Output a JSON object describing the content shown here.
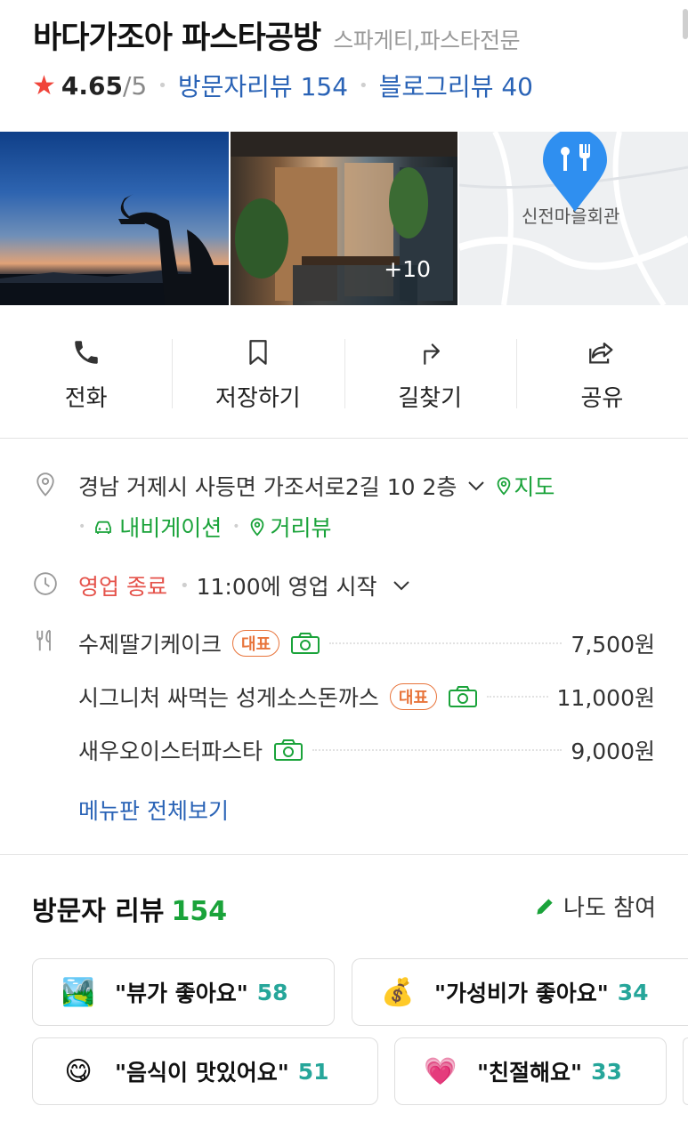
{
  "place": {
    "name": "바다가조아 파스타공방",
    "category": "스파게티,파스타전문",
    "rating": "4.65",
    "rating_max": "/5",
    "visitor_reviews_label": "방문자리뷰 154",
    "blog_reviews_label": "블로그리뷰 40"
  },
  "photos": {
    "more_count": "+10",
    "map_pin_label": "신전마을회관"
  },
  "actions": [
    {
      "label": "전화",
      "icon": "phone-icon"
    },
    {
      "label": "저장하기",
      "icon": "bookmark-icon"
    },
    {
      "label": "길찾기",
      "icon": "directions-icon"
    },
    {
      "label": "공유",
      "icon": "share-icon"
    }
  ],
  "address": {
    "text": "경남 거제시 사등면 가조서로2길 10 2층",
    "map_link": "지도",
    "navigation_link": "내비게이션",
    "streetview_link": "거리뷰"
  },
  "hours": {
    "status": "영업 종료",
    "next": "11:00에 영업 시작"
  },
  "menu": {
    "items": [
      {
        "name": "수제딸기케이크",
        "badge": "대표",
        "price": "7,500원"
      },
      {
        "name": "시그니처 싸먹는 성게소스돈까스",
        "badge": "대표",
        "price": "11,000원"
      },
      {
        "name": "새우오이스터파스타",
        "badge": "",
        "price": "9,000원"
      }
    ],
    "view_all": "메뉴판 전체보기"
  },
  "reviews": {
    "title": "방문자 리뷰",
    "count": "154",
    "join_label": "나도 참여",
    "keywords": [
      {
        "emoji": "🏞️",
        "label": "\"뷰가 좋아요\"",
        "count": "58"
      },
      {
        "emoji": "💰",
        "label": "\"가성비가 좋아요\"",
        "count": "34"
      },
      {
        "emoji": "😋",
        "label": "\"음식이 맛있어요\"",
        "count": "51"
      },
      {
        "emoji": "💗",
        "label": "\"친절해요\"",
        "count": "33"
      }
    ]
  },
  "colors": {
    "link_blue": "#2a63b6",
    "green": "#1aa33a",
    "red": "#e5534b",
    "badge_orange": "#e8743b",
    "pin_blue": "#2f8ff0"
  }
}
